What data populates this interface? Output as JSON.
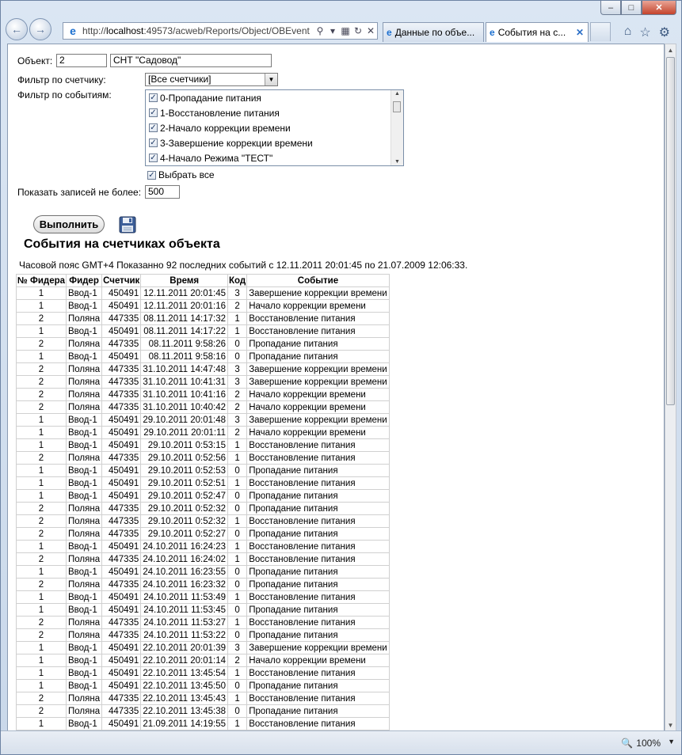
{
  "browser": {
    "url_prefix": "http://",
    "url_host": "localhost",
    "url_rest": ":49573/acweb/Reports/Object/OBEvent",
    "tabs": [
      {
        "label": "Данные по объе..."
      },
      {
        "label": "События на с..."
      }
    ],
    "zoom": "100%"
  },
  "form": {
    "object_label": "Объект:",
    "object_id": "2",
    "object_name": "СНТ \"Садовод\"",
    "meter_filter_label": "Фильтр по счетчику:",
    "meter_filter_value": "[Все счетчики]",
    "event_filter_label": "Фильтр по событиям:",
    "events": [
      {
        "label": "0-Пропадание питания",
        "checked": true
      },
      {
        "label": "1-Восстановление питания",
        "checked": true
      },
      {
        "label": "2-Начало коррекции времени",
        "checked": true
      },
      {
        "label": "3-Завершение коррекции времени",
        "checked": true
      },
      {
        "label": "4-Начало Режима \"ТЕСТ\"",
        "checked": true
      }
    ],
    "select_all_label": "Выбрать все",
    "limit_label": "Показать записей не более:",
    "limit_value": "500",
    "run_label": "Выполнить"
  },
  "report": {
    "title": "События на счетчиках объекта",
    "info": "Часовой пояс GMT+4 Показанно 92 последних событий с 12.11.2011 20:01:45 по 21.07.2009 12:06:33.",
    "columns": [
      "№ Фидера",
      "Фидер",
      "Счетчик",
      "Время",
      "Код",
      "Событие"
    ],
    "rows": [
      [
        "1",
        "Ввод-1",
        "450491",
        "12.11.2011 20:01:45",
        "3",
        "Завершение коррекции времени"
      ],
      [
        "1",
        "Ввод-1",
        "450491",
        "12.11.2011 20:01:16",
        "2",
        "Начало коррекции времени"
      ],
      [
        "2",
        "Поляна",
        "447335",
        "08.11.2011 14:17:32",
        "1",
        "Восстановление питания"
      ],
      [
        "1",
        "Ввод-1",
        "450491",
        "08.11.2011 14:17:22",
        "1",
        "Восстановление питания"
      ],
      [
        "2",
        "Поляна",
        "447335",
        "08.11.2011 9:58:26",
        "0",
        "Пропадание питания"
      ],
      [
        "1",
        "Ввод-1",
        "450491",
        "08.11.2011 9:58:16",
        "0",
        "Пропадание питания"
      ],
      [
        "2",
        "Поляна",
        "447335",
        "31.10.2011 14:47:48",
        "3",
        "Завершение коррекции времени"
      ],
      [
        "2",
        "Поляна",
        "447335",
        "31.10.2011 10:41:31",
        "3",
        "Завершение коррекции времени"
      ],
      [
        "2",
        "Поляна",
        "447335",
        "31.10.2011 10:41:16",
        "2",
        "Начало коррекции времени"
      ],
      [
        "2",
        "Поляна",
        "447335",
        "31.10.2011 10:40:42",
        "2",
        "Начало коррекции времени"
      ],
      [
        "1",
        "Ввод-1",
        "450491",
        "29.10.2011 20:01:48",
        "3",
        "Завершение коррекции времени"
      ],
      [
        "1",
        "Ввод-1",
        "450491",
        "29.10.2011 20:01:11",
        "2",
        "Начало коррекции времени"
      ],
      [
        "1",
        "Ввод-1",
        "450491",
        "29.10.2011 0:53:15",
        "1",
        "Восстановление питания"
      ],
      [
        "2",
        "Поляна",
        "447335",
        "29.10.2011 0:52:56",
        "1",
        "Восстановление питания"
      ],
      [
        "1",
        "Ввод-1",
        "450491",
        "29.10.2011 0:52:53",
        "0",
        "Пропадание питания"
      ],
      [
        "1",
        "Ввод-1",
        "450491",
        "29.10.2011 0:52:51",
        "1",
        "Восстановление питания"
      ],
      [
        "1",
        "Ввод-1",
        "450491",
        "29.10.2011 0:52:47",
        "0",
        "Пропадание питания"
      ],
      [
        "2",
        "Поляна",
        "447335",
        "29.10.2011 0:52:32",
        "0",
        "Пропадание питания"
      ],
      [
        "2",
        "Поляна",
        "447335",
        "29.10.2011 0:52:32",
        "1",
        "Восстановление питания"
      ],
      [
        "2",
        "Поляна",
        "447335",
        "29.10.2011 0:52:27",
        "0",
        "Пропадание питания"
      ],
      [
        "1",
        "Ввод-1",
        "450491",
        "24.10.2011 16:24:23",
        "1",
        "Восстановление питания"
      ],
      [
        "2",
        "Поляна",
        "447335",
        "24.10.2011 16:24:02",
        "1",
        "Восстановление питания"
      ],
      [
        "1",
        "Ввод-1",
        "450491",
        "24.10.2011 16:23:55",
        "0",
        "Пропадание питания"
      ],
      [
        "2",
        "Поляна",
        "447335",
        "24.10.2011 16:23:32",
        "0",
        "Пропадание питания"
      ],
      [
        "1",
        "Ввод-1",
        "450491",
        "24.10.2011 11:53:49",
        "1",
        "Восстановление питания"
      ],
      [
        "1",
        "Ввод-1",
        "450491",
        "24.10.2011 11:53:45",
        "0",
        "Пропадание питания"
      ],
      [
        "2",
        "Поляна",
        "447335",
        "24.10.2011 11:53:27",
        "1",
        "Восстановление питания"
      ],
      [
        "2",
        "Поляна",
        "447335",
        "24.10.2011 11:53:22",
        "0",
        "Пропадание питания"
      ],
      [
        "1",
        "Ввод-1",
        "450491",
        "22.10.2011 20:01:39",
        "3",
        "Завершение коррекции времени"
      ],
      [
        "1",
        "Ввод-1",
        "450491",
        "22.10.2011 20:01:14",
        "2",
        "Начало коррекции времени"
      ],
      [
        "1",
        "Ввод-1",
        "450491",
        "22.10.2011 13:45:54",
        "1",
        "Восстановление питания"
      ],
      [
        "1",
        "Ввод-1",
        "450491",
        "22.10.2011 13:45:50",
        "0",
        "Пропадание питания"
      ],
      [
        "2",
        "Поляна",
        "447335",
        "22.10.2011 13:45:43",
        "1",
        "Восстановление питания"
      ],
      [
        "2",
        "Поляна",
        "447335",
        "22.10.2011 13:45:38",
        "0",
        "Пропадание питания"
      ],
      [
        "1",
        "Ввод-1",
        "450491",
        "21.09.2011 14:19:55",
        "1",
        "Восстановление питания"
      ]
    ]
  }
}
